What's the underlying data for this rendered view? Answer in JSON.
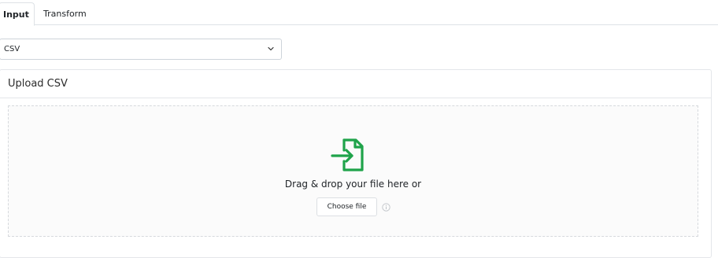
{
  "tabs": [
    {
      "label": "Input",
      "active": true
    },
    {
      "label": "Transform",
      "active": false
    }
  ],
  "format_select": {
    "value": "CSV",
    "icon": "chevron-down-icon"
  },
  "upload_card": {
    "title": "Upload CSV",
    "dropzone": {
      "icon": "file-import-icon",
      "icon_color": "#1fa34a",
      "prompt": "Drag & drop your file here or",
      "button_label": "Choose file",
      "info_icon": "info-icon"
    }
  }
}
